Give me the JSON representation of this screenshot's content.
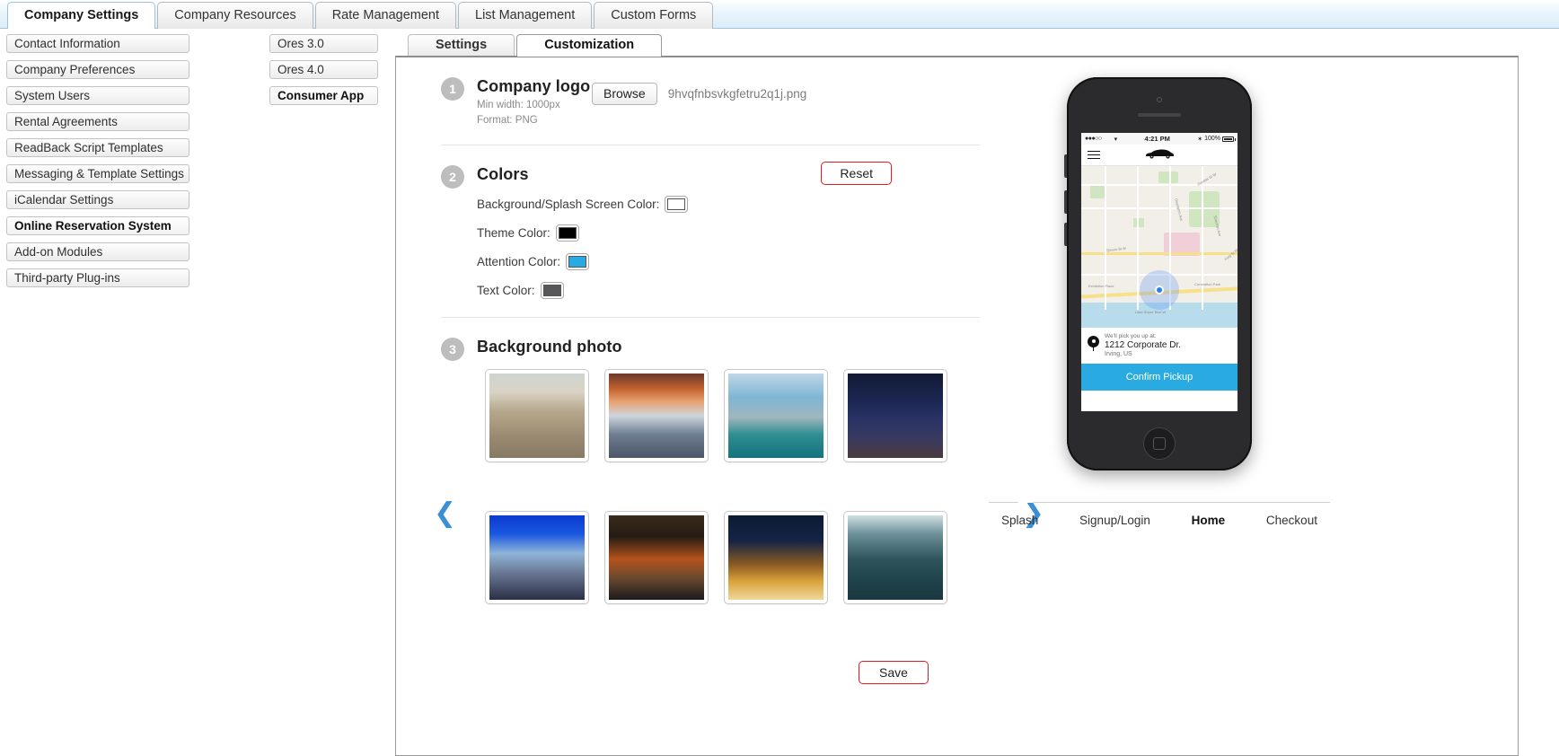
{
  "top_tabs": [
    {
      "label": "Company Settings",
      "active": true
    },
    {
      "label": "Company Resources",
      "active": false
    },
    {
      "label": "Rate Management",
      "active": false
    },
    {
      "label": "List Management",
      "active": false
    },
    {
      "label": "Custom Forms",
      "active": false
    }
  ],
  "sidebar": {
    "items": [
      {
        "label": "Contact Information",
        "selected": false
      },
      {
        "label": "Company Preferences",
        "selected": false
      },
      {
        "label": "System Users",
        "selected": false
      },
      {
        "label": "Rental Agreements",
        "selected": false
      },
      {
        "label": "ReadBack Script Templates",
        "selected": false
      },
      {
        "label": "Messaging & Template Settings",
        "selected": false
      },
      {
        "label": "iCalendar Settings",
        "selected": false
      },
      {
        "label": "Online Reservation System",
        "selected": true
      },
      {
        "label": "Add-on Modules",
        "selected": false
      },
      {
        "label": "Third-party Plug-ins",
        "selected": false
      }
    ]
  },
  "subnav": {
    "items": [
      {
        "label": "Ores 3.0",
        "selected": false
      },
      {
        "label": "Ores 4.0",
        "selected": false
      },
      {
        "label": "Consumer App",
        "selected": true
      }
    ]
  },
  "inner_tabs": [
    {
      "label": "Settings",
      "active": false
    },
    {
      "label": "Customization",
      "active": true
    }
  ],
  "sections": {
    "logo": {
      "number": "1",
      "title": "Company logo",
      "hint_line1": "Min width: 1000px",
      "hint_line2": "Format: PNG",
      "browse_label": "Browse",
      "filename": "9hvqfnbsvkgfetru2q1j.png"
    },
    "colors": {
      "number": "2",
      "title": "Colors",
      "reset_label": "Reset",
      "rows": [
        {
          "label": "Background/Splash Screen Color:",
          "value": "#ffffff"
        },
        {
          "label": "Theme Color:",
          "value": "#000000"
        },
        {
          "label": "Attention Color:",
          "value": "#29abe2"
        },
        {
          "label": "Text Color:",
          "value": "#58585a"
        }
      ]
    },
    "background_photo": {
      "number": "3",
      "title": "Background photo",
      "prev_arrow": "❮",
      "next_arrow": "❯",
      "thumbnails": [
        {
          "name": "daytime-city-skyline-aerial"
        },
        {
          "name": "sunset-clouds-over-downtown"
        },
        {
          "name": "waterfront-marina-modern-building"
        },
        {
          "name": "night-bokeh-city-lights"
        },
        {
          "name": "car-motion-blur-blue-sky"
        },
        {
          "name": "underpass-highway-light-trails"
        },
        {
          "name": "night-city-light-trails-road"
        },
        {
          "name": "teal-toned-highrise-buildings"
        }
      ]
    }
  },
  "save_label": "Save",
  "preview": {
    "status_bar": {
      "signal": "●●●○○",
      "wifi": "▾",
      "time": "4:21 PM",
      "bluetooth": "✶",
      "battery": "100%"
    },
    "app_bar": {
      "menu_icon": "hamburger-icon",
      "logo_icon": "car-icon"
    },
    "map_labels": [
      "Dundas St W",
      "Ossington Ave",
      "Queen St W",
      "Strachan Ave",
      "King St W",
      "Exhibition Place",
      "Coronation Park",
      "Lake Shore Blvd W"
    ],
    "pickup": {
      "prompt": "We'll pick you up at:",
      "address": "1212 Corporate Dr.",
      "city": "Irving, US",
      "confirm_label": "Confirm Pickup"
    },
    "nav": [
      {
        "label": "Splash",
        "active": false
      },
      {
        "label": "Signup/Login",
        "active": false
      },
      {
        "label": "Home",
        "active": true
      },
      {
        "label": "Checkout",
        "active": false
      }
    ]
  }
}
